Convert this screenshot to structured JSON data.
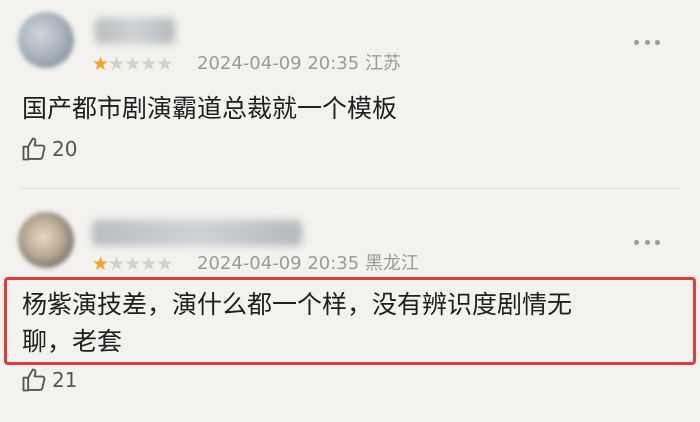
{
  "comments": [
    {
      "rating": 1,
      "rating_max": 5,
      "datetime": "2024-04-09 20:35",
      "location": "江苏",
      "text": "国产都市剧演霸道总裁就一个模板",
      "likes": "20",
      "avatar_icon": "avatar-blurred",
      "highlighted": false
    },
    {
      "rating": 1,
      "rating_max": 5,
      "datetime": "2024-04-09 20:35",
      "location": "黑龙江",
      "text_line1": "杨紫演技差，演什么都一个样，没有辨识度剧情无",
      "text_line2": "聊，老套",
      "likes": "21",
      "avatar_icon": "avatar-blurred",
      "highlighted": true,
      "highlight_color": "#e23b3b"
    }
  ],
  "colors": {
    "star_on": "#f5a623",
    "star_off": "#d0d0d0",
    "meta": "#9a9a9a",
    "background": "#f4f2ee"
  }
}
